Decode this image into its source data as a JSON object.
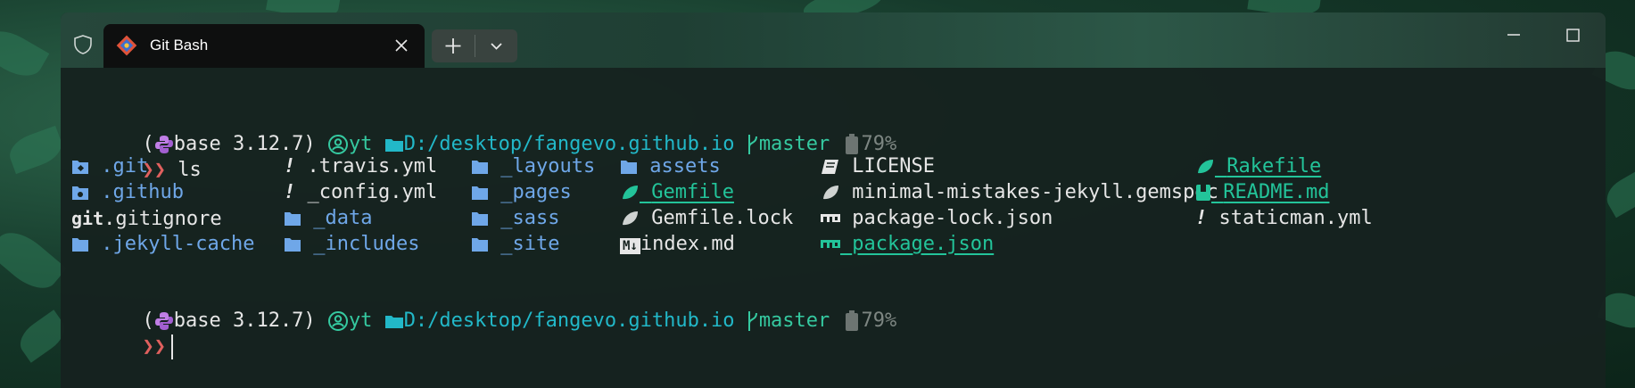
{
  "tab": {
    "title": "Git Bash"
  },
  "prompt": {
    "open_paren": "(",
    "env": "base 3.12.7)",
    "user": "yt",
    "path": "D:/desktop/fangevo.github.io",
    "branch": "master",
    "battery": "79%",
    "symbol": "❯❯"
  },
  "command": "ls",
  "listing": [
    [
      {
        "name": ".git"
      },
      {
        "name": ".travis.yml"
      },
      {
        "name": "_layouts"
      },
      {
        "name": "assets"
      },
      {
        "name": "LICENSE"
      },
      {
        "name": "Rakefile"
      }
    ],
    [
      {
        "name": ".github"
      },
      {
        "name": "_config.yml"
      },
      {
        "name": "_pages"
      },
      {
        "name": "Gemfile"
      },
      {
        "name": "minimal-mistakes-jekyll.gemspec"
      },
      {
        "name": "README.md"
      }
    ],
    [
      {
        "name": ".gitignore"
      },
      {
        "name": "_data"
      },
      {
        "name": "_sass"
      },
      {
        "name": "Gemfile.lock"
      },
      {
        "name": "package-lock.json"
      },
      {
        "name": "staticman.yml"
      }
    ],
    [
      {
        "name": ".jekyll-cache"
      },
      {
        "name": "_includes"
      },
      {
        "name": "_site"
      },
      {
        "name": "index.md"
      },
      {
        "name": "package.json"
      }
    ]
  ],
  "icons": {
    "git_label": "git",
    "bang": "!",
    "markdown": "M↓"
  },
  "colors": {
    "directory": "#6fa7e8",
    "file": "#e6e6e6",
    "link_file": "#23c49a",
    "path": "#22b8c8",
    "branch": "#35c9a0",
    "prompt_arrow": "#e0605e",
    "python": "#c07ee6"
  }
}
